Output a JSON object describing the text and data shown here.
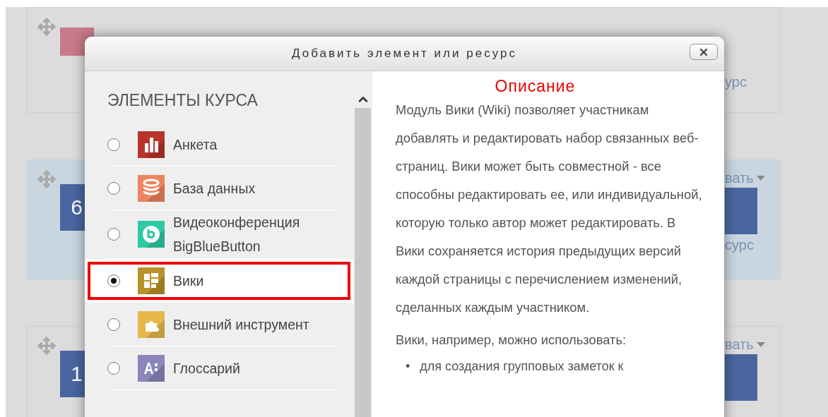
{
  "background": {
    "cards": [
      {
        "link": "урс",
        "highlighted": false
      },
      {
        "number": "6",
        "tag": "вать",
        "link": "сурс",
        "highlighted": true
      },
      {
        "number": "1",
        "tag": "вать",
        "highlighted": false
      }
    ]
  },
  "dialog": {
    "title": "Добавить элемент или ресурс",
    "list": {
      "heading": "ЭЛЕМЕНТЫ КУРСА",
      "items": [
        {
          "label": "Анкета",
          "kind": "chart",
          "color": "#b8342a",
          "selected": false
        },
        {
          "label": "База данных",
          "kind": "database",
          "color": "#f0835f",
          "selected": false
        },
        {
          "label": "Видеоконференция BigBlueButton",
          "kind": "bigbluebutton",
          "color": "#2ec9a7",
          "selected": false
        },
        {
          "label": "Вики",
          "kind": "wiki",
          "color": "#b8912a",
          "selected": true
        },
        {
          "label": "Внешний инструмент",
          "kind": "puzzle",
          "color": "#e5b84a",
          "selected": false
        },
        {
          "label": "Глоссарий",
          "kind": "glossary",
          "color": "#8a86bb",
          "selected": false
        }
      ]
    },
    "description": {
      "heading": "Описание",
      "paragraphs": [
        "Модуль Вики (Wiki) позволяет участникам добавлять и редактировать набор связанных веб-страниц. Вики может быть совместной - все способны редактировать ее, или индивидуальной, которую только автор может редактировать. В Вики сохраняется история предыдущих версий каждой страницы с перечислением изменений, сделанных каждым участником.",
        "Вики, например, можно использовать:"
      ],
      "bullets": [
        {
          "marker": "•",
          "text": "для создания групповых заметок к"
        }
      ]
    }
  }
}
